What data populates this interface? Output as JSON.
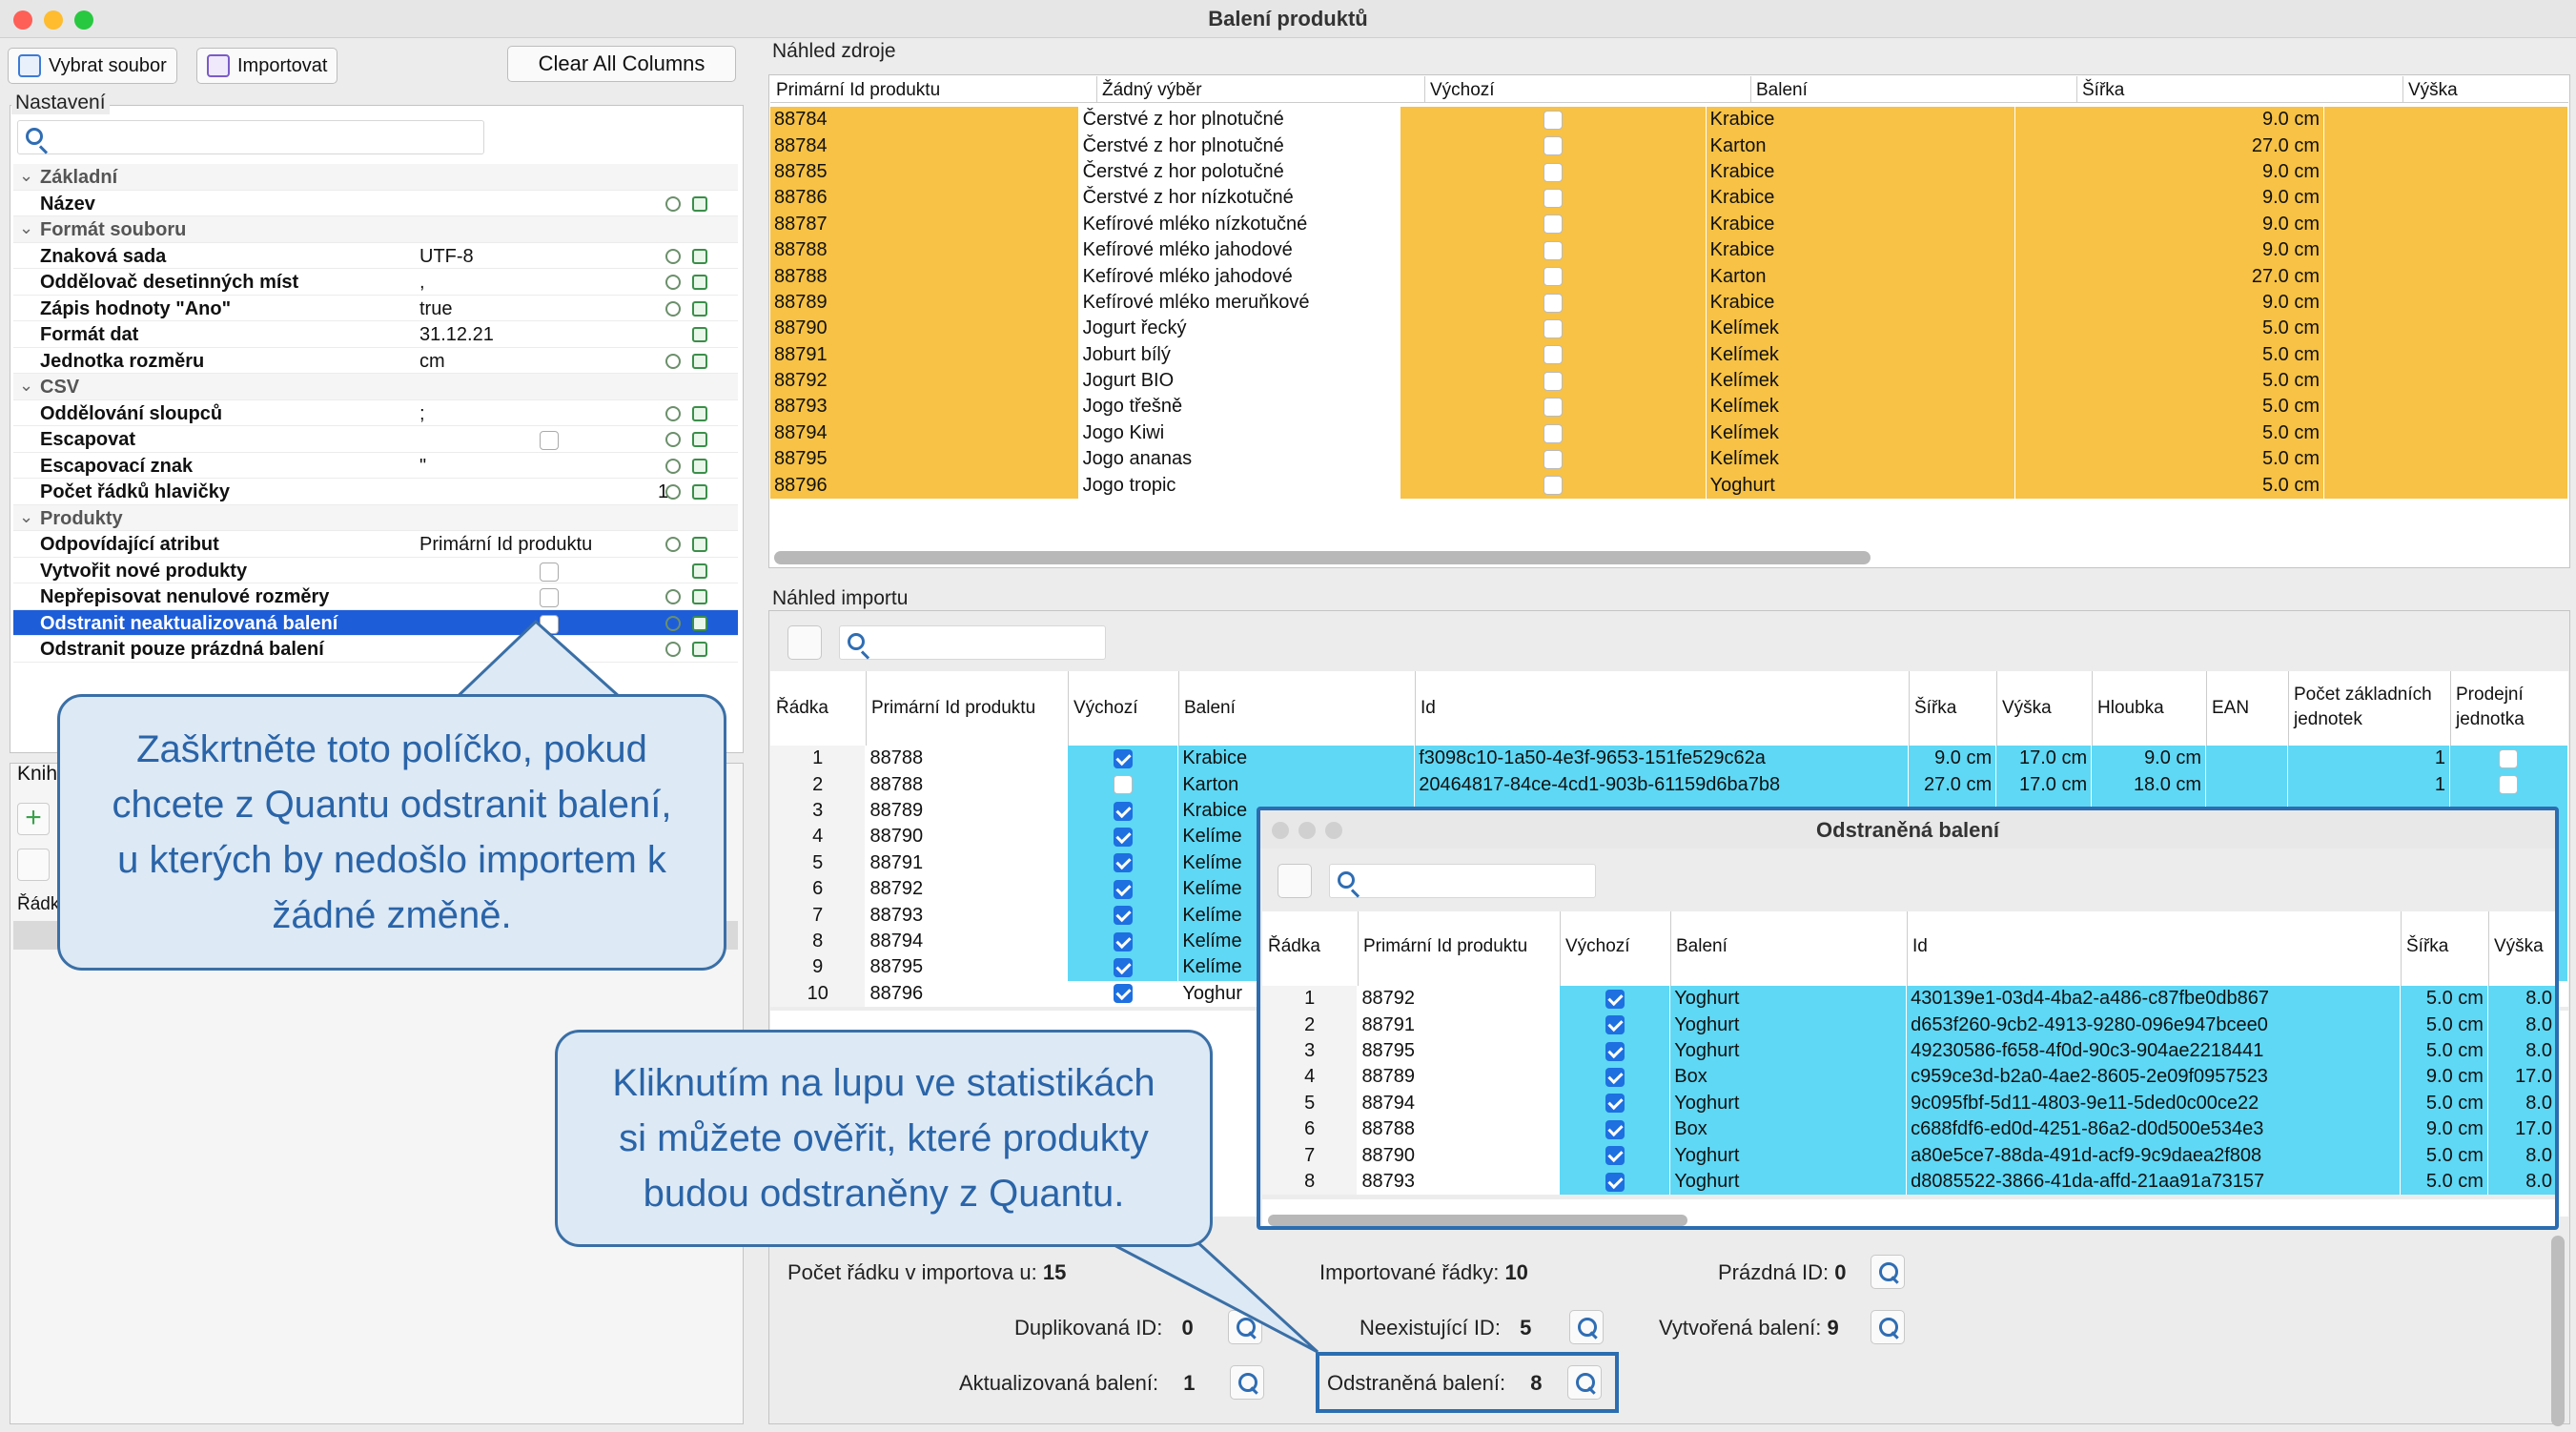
{
  "window": {
    "title": "Balení produktů"
  },
  "toolbar": {
    "select_file": "Vybrat soubor",
    "import": "Importovat",
    "clear_columns": "Clear All Columns"
  },
  "settings": {
    "label": "Nastavení",
    "rows": [
      {
        "type": "group",
        "key": "Základní"
      },
      {
        "type": "prop",
        "key": "Název",
        "value": ""
      },
      {
        "type": "group",
        "key": "Formát souboru"
      },
      {
        "type": "prop",
        "key": "Znaková sada",
        "value": "UTF-8"
      },
      {
        "type": "prop",
        "key": "Oddělovač desetinných míst",
        "value": ","
      },
      {
        "type": "prop",
        "key": "Zápis hodnoty \"Ano\"",
        "value": "true"
      },
      {
        "type": "prop",
        "key": "Formát dat",
        "value": "31.12.21"
      },
      {
        "type": "prop",
        "key": "Jednotka rozměru",
        "value": "cm"
      },
      {
        "type": "group",
        "key": "CSV"
      },
      {
        "type": "prop",
        "key": "Oddělování sloupců",
        "value": ";"
      },
      {
        "type": "check",
        "key": "Escapovat",
        "value": ""
      },
      {
        "type": "prop",
        "key": "Escapovací znak",
        "value": "\""
      },
      {
        "type": "num",
        "key": "Počet řádků hlavičky",
        "value": "1"
      },
      {
        "type": "group",
        "key": "Produkty"
      },
      {
        "type": "prop",
        "key": "Odpovídající atribut",
        "value": "Primární Id produktu"
      },
      {
        "type": "check",
        "key": "Vytvořit nové produkty",
        "value": ""
      },
      {
        "type": "check",
        "key": "Nepřepisovat nenulové rozměry",
        "value": ""
      },
      {
        "type": "sel",
        "key": "Odstranit neaktualizovaná balení",
        "value": ""
      },
      {
        "type": "prop",
        "key": "Odstranit pouze prázdná balení",
        "value": ""
      }
    ]
  },
  "library": {
    "label_partial": "Kniha",
    "col_partial": "Řádk"
  },
  "source_preview": {
    "label": "Náhled zdroje",
    "headers": [
      "Primární Id produktu",
      "Žádný výběr",
      "Výchozí",
      "Balení",
      "Šířka",
      "Výška"
    ],
    "rows": [
      [
        "88784",
        "Čerstvé z hor plnotučné",
        "",
        "Krabice",
        "9.0 cm"
      ],
      [
        "88784",
        "Čerstvé z hor plnotučné",
        "",
        "Karton",
        "27.0 cm"
      ],
      [
        "88785",
        "Čerstvé z hor polotučné",
        "",
        "Krabice",
        "9.0 cm"
      ],
      [
        "88786",
        "Čerstvé z hor nízkotučné",
        "",
        "Krabice",
        "9.0 cm"
      ],
      [
        "88787",
        "Kefírové mléko nízkotučné",
        "",
        "Krabice",
        "9.0 cm"
      ],
      [
        "88788",
        "Kefírové mléko jahodové",
        "",
        "Krabice",
        "9.0 cm"
      ],
      [
        "88788",
        "Kefírové mléko jahodové",
        "",
        "Karton",
        "27.0 cm"
      ],
      [
        "88789",
        "Kefírové mléko meruňkové",
        "",
        "Krabice",
        "9.0 cm"
      ],
      [
        "88790",
        "Jogurt řecký",
        "",
        "Kelímek",
        "5.0 cm"
      ],
      [
        "88791",
        "Joburt bílý",
        "",
        "Kelímek",
        "5.0 cm"
      ],
      [
        "88792",
        "Jogurt BIO",
        "",
        "Kelímek",
        "5.0 cm"
      ],
      [
        "88793",
        "Jogo třešně",
        "",
        "Kelímek",
        "5.0 cm"
      ],
      [
        "88794",
        "Jogo Kiwi",
        "",
        "Kelímek",
        "5.0 cm"
      ],
      [
        "88795",
        "Jogo ananas",
        "",
        "Kelímek",
        "5.0 cm"
      ],
      [
        "88796",
        "Jogo tropic",
        "",
        "Yoghurt",
        "5.0 cm"
      ]
    ]
  },
  "import_preview": {
    "label": "Náhled importu",
    "headers": [
      "Řádka",
      "Primární Id produktu",
      "Výchozí",
      "Balení",
      "Id",
      "Šířka",
      "Výška",
      "Hloubka",
      "EAN",
      "Počet základních jednotek",
      "Prodejní jednotka"
    ],
    "rows": [
      {
        "n": "1",
        "pid": "88788",
        "def": true,
        "pkg": "Krabice",
        "id": "f3098c10-1a50-4e3f-9653-151fe529c62a",
        "w": "9.0 cm",
        "h": "17.0 cm",
        "d": "9.0 cm",
        "units": "1"
      },
      {
        "n": "2",
        "pid": "88788",
        "def": false,
        "pkg": "Karton",
        "id": "20464817-84ce-4cd1-903b-61159d6ba7b8",
        "w": "27.0 cm",
        "h": "17.0 cm",
        "d": "18.0 cm",
        "units": "1"
      },
      {
        "n": "3",
        "pid": "88789",
        "def": true,
        "pkg": "Krabice"
      },
      {
        "n": "4",
        "pid": "88790",
        "def": true,
        "pkg": "Kelíme"
      },
      {
        "n": "5",
        "pid": "88791",
        "def": true,
        "pkg": "Kelíme"
      },
      {
        "n": "6",
        "pid": "88792",
        "def": true,
        "pkg": "Kelíme"
      },
      {
        "n": "7",
        "pid": "88793",
        "def": true,
        "pkg": "Kelíme"
      },
      {
        "n": "8",
        "pid": "88794",
        "def": true,
        "pkg": "Kelíme"
      },
      {
        "n": "9",
        "pid": "88795",
        "def": true,
        "pkg": "Kelíme"
      },
      {
        "n": "10",
        "pid": "88796",
        "def": true,
        "pkg": "Yoghur"
      }
    ]
  },
  "stats": {
    "rows_in_import_label": "Počet řádku v importova",
    "rows_in_import_suffix": "u:",
    "rows_in_import_value": "15",
    "imported_rows_label": "Importované řádky:",
    "imported_rows_value": "10",
    "empty_id_label": "Prázdná ID:",
    "empty_id_value": "0",
    "dup_id_label": "Duplikovaná ID:",
    "dup_id_value": "0",
    "nonexist_id_label": "Neexistující ID:",
    "nonexist_id_value": "5",
    "created_label": "Vytvořená balení:",
    "created_value": "9",
    "updated_label": "Aktualizovaná balení:",
    "updated_value": "1",
    "removed_label": "Odstraněná balení:",
    "removed_value": "8"
  },
  "modal": {
    "title": "Odstraněná balení",
    "headers": [
      "Řádka",
      "Primární Id produktu",
      "Výchozí",
      "Balení",
      "Id",
      "Šířka",
      "Výška"
    ],
    "rows": [
      [
        "1",
        "88792",
        "Yoghurt",
        "430139e1-03d4-4ba2-a486-c87fbe0db867",
        "5.0 cm",
        "8.0"
      ],
      [
        "2",
        "88791",
        "Yoghurt",
        "d653f260-9cb2-4913-9280-096e947bcee0",
        "5.0 cm",
        "8.0"
      ],
      [
        "3",
        "88795",
        "Yoghurt",
        "49230586-f658-4f0d-90c3-904ae2218441",
        "5.0 cm",
        "8.0"
      ],
      [
        "4",
        "88789",
        "Box",
        "c959ce3d-b2a0-4ae2-8605-2e09f0957523",
        "9.0 cm",
        "17.0"
      ],
      [
        "5",
        "88794",
        "Yoghurt",
        "9c095fbf-5d11-4803-9e11-5ded0c00ce22",
        "5.0 cm",
        "8.0"
      ],
      [
        "6",
        "88788",
        "Box",
        "c688fdf6-ed0d-4251-86a2-d0d500e534e3",
        "9.0 cm",
        "17.0"
      ],
      [
        "7",
        "88790",
        "Yoghurt",
        "a80e5ce7-88da-491d-acf9-9c9daea2f808",
        "5.0 cm",
        "8.0"
      ],
      [
        "8",
        "88793",
        "Yoghurt",
        "d8085522-3866-41da-affd-21aa91a73157",
        "5.0 cm",
        "8.0"
      ]
    ]
  },
  "callouts": {
    "checkbox_tip": "Zaškrtněte toto políčko, pokud chcete z Quantu odstranit balení, u kterých by nedošlo importem k žádné změně.",
    "magnifier_tip": "Kliknutím na lupu ve statistikách si můžete ověřit, které produkty budou odstraněny z Quantu."
  },
  "colors": {
    "orange_row": "#f7c245",
    "cyan_row": "#5ed8f5",
    "selection": "#1e5dd8",
    "callout_border": "#3a6fa6"
  }
}
